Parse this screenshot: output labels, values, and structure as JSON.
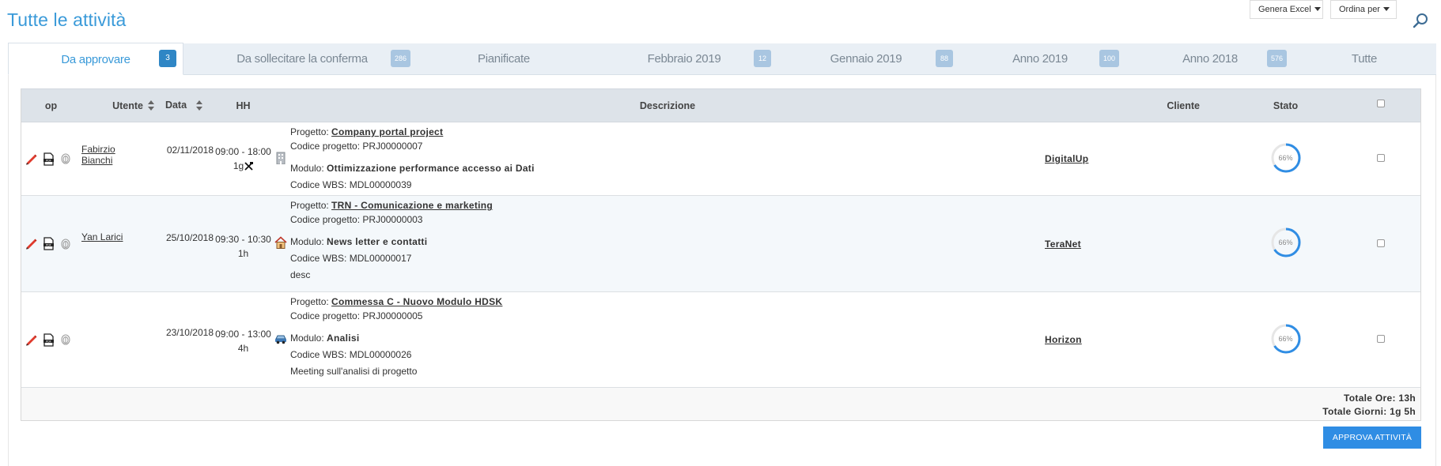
{
  "page_title": "Tutte le attività",
  "toolbar": {
    "excel_label": "Genera Excel",
    "sort_label": "Ordina per",
    "search_icon": "search-icon"
  },
  "tabs": [
    {
      "label": "Da approvare",
      "badge": "3",
      "active": true
    },
    {
      "label": "Da sollecitare la conferma",
      "badge": "286"
    },
    {
      "label": "Pianificate",
      "badge": ""
    },
    {
      "label": "Febbraio 2019",
      "badge": "12"
    },
    {
      "label": "Gennaio 2019",
      "badge": "88"
    },
    {
      "label": "Anno 2019",
      "badge": "100"
    },
    {
      "label": "Anno 2018",
      "badge": "576"
    },
    {
      "label": "Tutte",
      "badge": ""
    }
  ],
  "table": {
    "headers": {
      "op": "op",
      "user": "Utente",
      "date": "Data",
      "hh": "HH",
      "desc": "Descrizione",
      "client": "Cliente",
      "state": "Stato"
    },
    "labels": {
      "project": "Progetto:",
      "project_code": "Codice progetto:",
      "module": "Modulo:",
      "wbs_code": "Codice WBS:"
    },
    "rows": [
      {
        "user": "Fabirzio Bianchi",
        "date": "02/11/2018",
        "time": "09:00 - 18:00",
        "duration": "1g",
        "type_icon": "building-icon",
        "project": "Company portal project",
        "project_code": "PRJ00000007",
        "module": "Ottimizzazione performance accesso ai Dati",
        "wbs": "MDL00000039",
        "note": "",
        "client": "DigitalUp",
        "progress": "66%"
      },
      {
        "user": "Yan Larici",
        "date": "25/10/2018",
        "time": "09:30 - 10:30",
        "duration": "1h",
        "type_icon": "home-icon",
        "project": "TRN - Comunicazione e marketing",
        "project_code": "PRJ00000003",
        "module": "News letter e contatti",
        "wbs": "MDL00000017",
        "note": "desc",
        "client": "TeraNet",
        "progress": "66%"
      },
      {
        "user": "",
        "date": "23/10/2018",
        "time": "09:00 - 13:00",
        "duration": "4h",
        "type_icon": "car-icon",
        "project": "Commessa C - Nuovo Modulo HDSK",
        "project_code": "PRJ00000005",
        "module": "Analisi",
        "wbs": "MDL00000026",
        "note": "Meeting sull'analisi di progetto",
        "client": "Horizon",
        "progress": "66%"
      }
    ],
    "totals": {
      "hours": "Totale Ore: 13h",
      "days": "Totale Giorni: 1g 5h"
    }
  },
  "approve_button": "APPROVA ATTIVITÀ",
  "colors": {
    "accent": "#3a9ad9",
    "button": "#2f8de4",
    "badge": "#a9c6e1",
    "badge_active": "#2f86c5",
    "header_bg": "#dde3e9",
    "edit": "#e03a2c"
  }
}
